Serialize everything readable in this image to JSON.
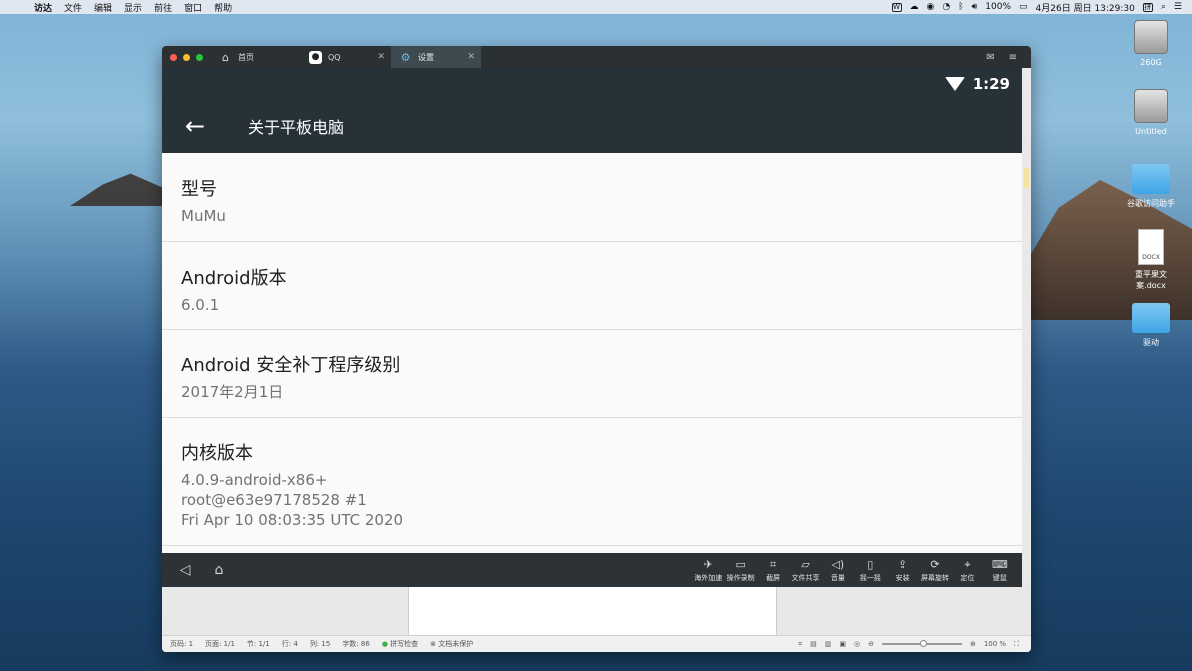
{
  "menubar": {
    "items": [
      "访达",
      "文件",
      "编辑",
      "显示",
      "前往",
      "窗口",
      "帮助"
    ],
    "battery": "100%",
    "datetime": "4月26日 周日  13:29:30",
    "input_method": "拼"
  },
  "desktop": {
    "icons": [
      {
        "label": "260G",
        "kind": "disk"
      },
      {
        "label": "Untitled",
        "kind": "disk"
      },
      {
        "label": "谷歌访问助手",
        "kind": "folder"
      },
      {
        "label": "重平果文案.docx",
        "kind": "doc",
        "badge": "DOCX"
      },
      {
        "label": "驱动",
        "kind": "folder"
      }
    ]
  },
  "window": {
    "tabs": [
      {
        "label": "首页",
        "icon": "home-icon"
      },
      {
        "label": "QQ",
        "icon": "qq-icon"
      },
      {
        "label": "设置",
        "icon": "gear-icon"
      }
    ],
    "status_time": "1:29",
    "appbar_title": "关于平板电脑",
    "rows": [
      {
        "label": "型号",
        "values": [
          "MuMu"
        ]
      },
      {
        "label": "Android版本",
        "values": [
          "6.0.1"
        ]
      },
      {
        "label": "Android 安全补丁程序级别",
        "values": [
          "2017年2月1日"
        ]
      },
      {
        "label": "内核版本",
        "values": [
          "4.0.9-android-x86+",
          "root@e63e97178528 #1",
          "Fri Apr 10 08:03:35 UTC 2020"
        ]
      }
    ],
    "tools": [
      {
        "label": "海外加速",
        "icon": "accelerate-icon"
      },
      {
        "label": "操作录制",
        "icon": "record-icon"
      },
      {
        "label": "截屏",
        "icon": "crop-icon"
      },
      {
        "label": "文件共享",
        "icon": "folder-share-icon"
      },
      {
        "label": "音量",
        "icon": "volume-icon"
      },
      {
        "label": "摇一摇",
        "icon": "shake-icon"
      },
      {
        "label": "安装",
        "icon": "apk-install-icon"
      },
      {
        "label": "屏幕旋转",
        "icon": "rotate-screen-icon"
      },
      {
        "label": "定位",
        "icon": "location-icon"
      },
      {
        "label": "键鼠",
        "icon": "keyboard-icon"
      }
    ]
  },
  "word_status": {
    "page": "页码: 1",
    "pages": "页面: 1/1",
    "section": "节: 1/1",
    "line": "行: 4",
    "column": "列: 15",
    "word_count": "字数: 86",
    "spell_check": "拼写检查",
    "doc_protect": "文档未保护",
    "zoom": "100 %"
  }
}
